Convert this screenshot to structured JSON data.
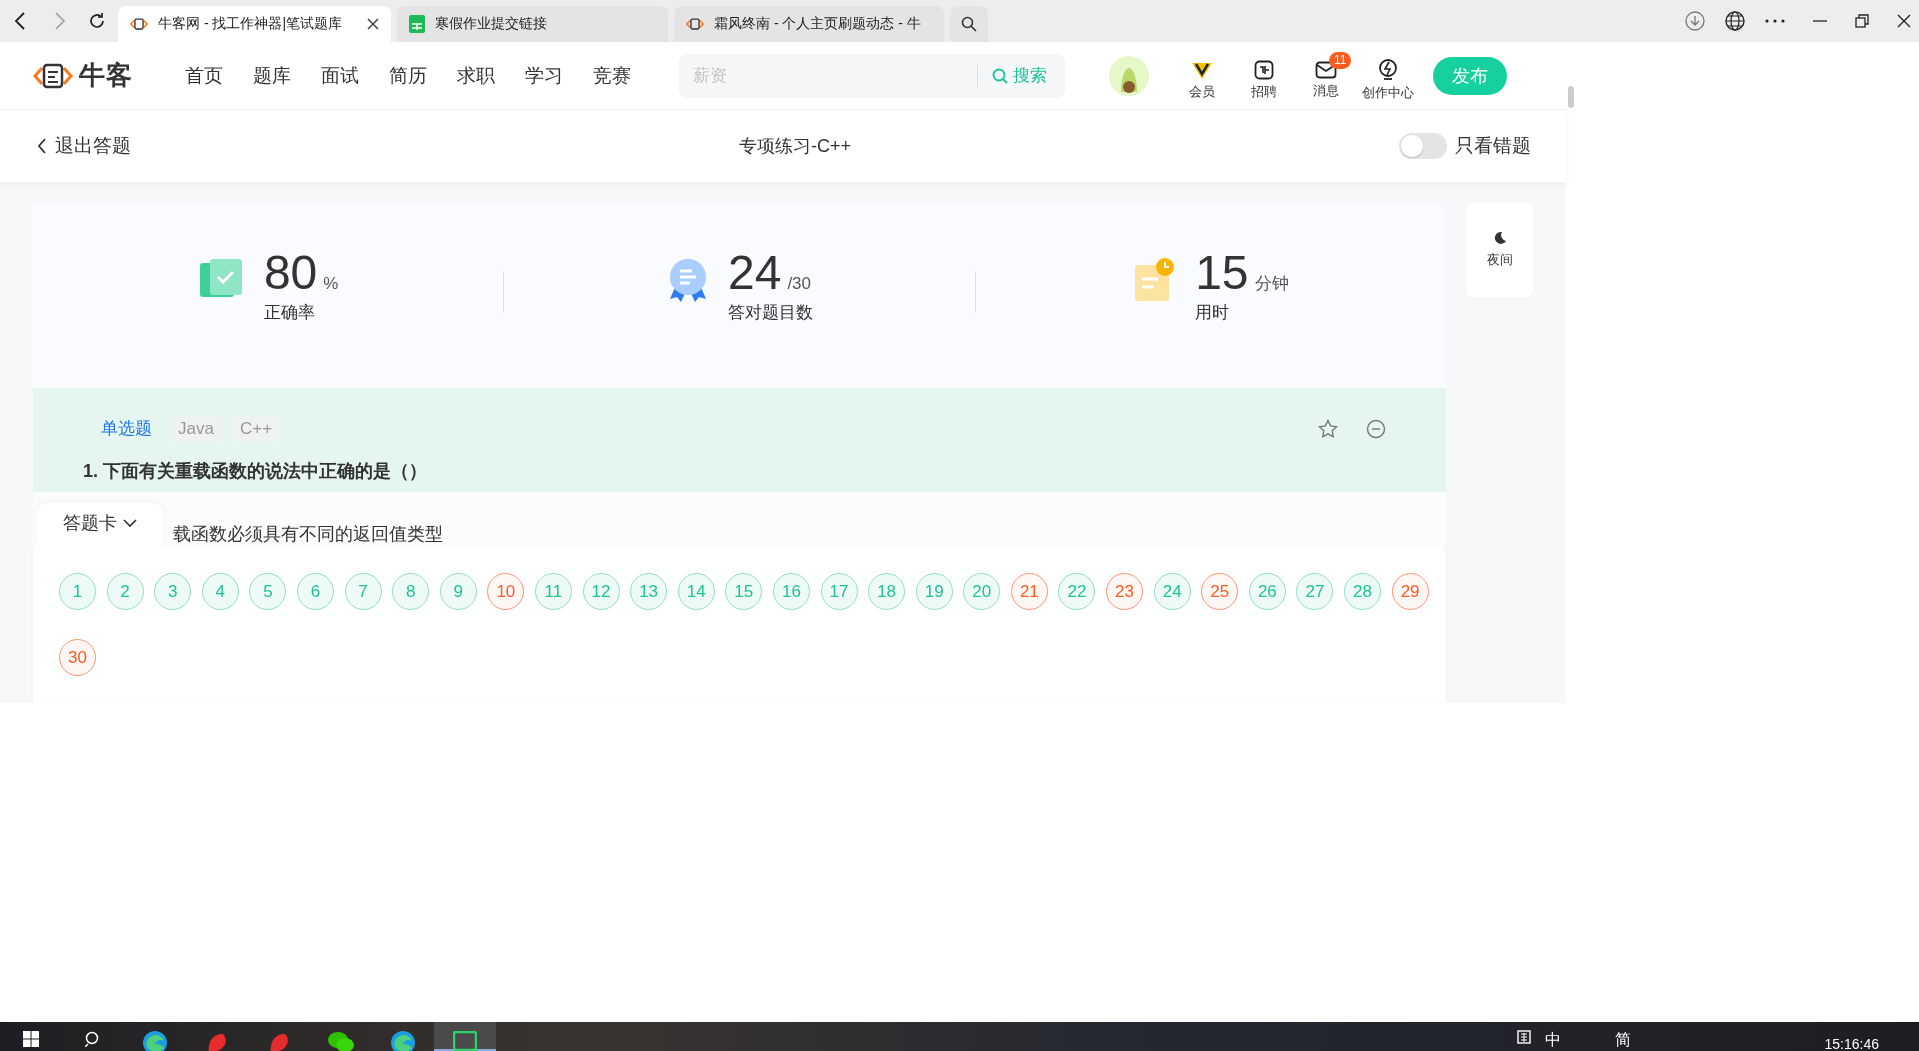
{
  "browser": {
    "tabs": [
      {
        "title": "牛客网 - 找工作神器|笔试题库",
        "selected": true,
        "closable": true
      },
      {
        "title": "寒假作业提交链接",
        "selected": false,
        "closable": false
      },
      {
        "title": "霜风终南 - 个人主页刷题动态 - 牛",
        "selected": false,
        "closable": false
      }
    ]
  },
  "nav": {
    "logo": "牛客",
    "items": [
      "首页",
      "题库",
      "面试",
      "简历",
      "求职",
      "学习",
      "竞赛"
    ],
    "search": {
      "placeholder": "薪资",
      "button": "搜索"
    },
    "actions": [
      {
        "kind": "vip",
        "label": "会员"
      },
      {
        "kind": "jobs",
        "label": "招聘"
      },
      {
        "kind": "messages",
        "label": "消息",
        "badge": "11"
      },
      {
        "kind": "create",
        "label": "创作中心"
      }
    ],
    "publish": "发布"
  },
  "subheader": {
    "back": "退出答题",
    "title": "专项练习-C++",
    "wrong_only": {
      "label": "只看错题",
      "on": false
    }
  },
  "stats": [
    {
      "kind": "accuracy",
      "value": "80",
      "unit": "%",
      "label": "正确率"
    },
    {
      "kind": "correct",
      "value": "24",
      "unit": "/30",
      "label": "答对题目数"
    },
    {
      "kind": "time",
      "value": "15",
      "unit": "分钟",
      "label": "用时"
    }
  ],
  "night": "夜间",
  "question": {
    "tags": [
      {
        "label": "单选题",
        "kind": "type"
      },
      {
        "label": "Java",
        "kind": "topic"
      },
      {
        "label": "C++",
        "kind": "topic"
      }
    ],
    "text": "1. 下面有关重载函数的说法中正确的是（）",
    "option_partial": "载函数必须具有不同的返回值类型"
  },
  "answer_card": {
    "title": "答题卡",
    "expanded": true,
    "items": [
      {
        "number": "1",
        "correct": true
      },
      {
        "number": "2",
        "correct": true
      },
      {
        "number": "3",
        "correct": true
      },
      {
        "number": "4",
        "correct": true
      },
      {
        "number": "5",
        "correct": true
      },
      {
        "number": "6",
        "correct": true
      },
      {
        "number": "7",
        "correct": true
      },
      {
        "number": "8",
        "correct": true
      },
      {
        "number": "9",
        "correct": true
      },
      {
        "number": "10",
        "correct": false
      },
      {
        "number": "11",
        "correct": true
      },
      {
        "number": "12",
        "correct": true
      },
      {
        "number": "13",
        "correct": true
      },
      {
        "number": "14",
        "correct": true
      },
      {
        "number": "15",
        "correct": true
      },
      {
        "number": "16",
        "correct": true
      },
      {
        "number": "17",
        "correct": true
      },
      {
        "number": "18",
        "correct": true
      },
      {
        "number": "19",
        "correct": true
      },
      {
        "number": "20",
        "correct": true
      },
      {
        "number": "21",
        "correct": false
      },
      {
        "number": "22",
        "correct": true
      },
      {
        "number": "23",
        "correct": false
      },
      {
        "number": "24",
        "correct": true
      },
      {
        "number": "25",
        "correct": false
      },
      {
        "number": "26",
        "correct": true
      },
      {
        "number": "27",
        "correct": true
      },
      {
        "number": "28",
        "correct": true
      },
      {
        "number": "29",
        "correct": false
      },
      {
        "number": "30",
        "correct": false
      }
    ]
  },
  "taskbar": {
    "ime": [
      "中",
      "简"
    ],
    "time": "15:16:46"
  }
}
